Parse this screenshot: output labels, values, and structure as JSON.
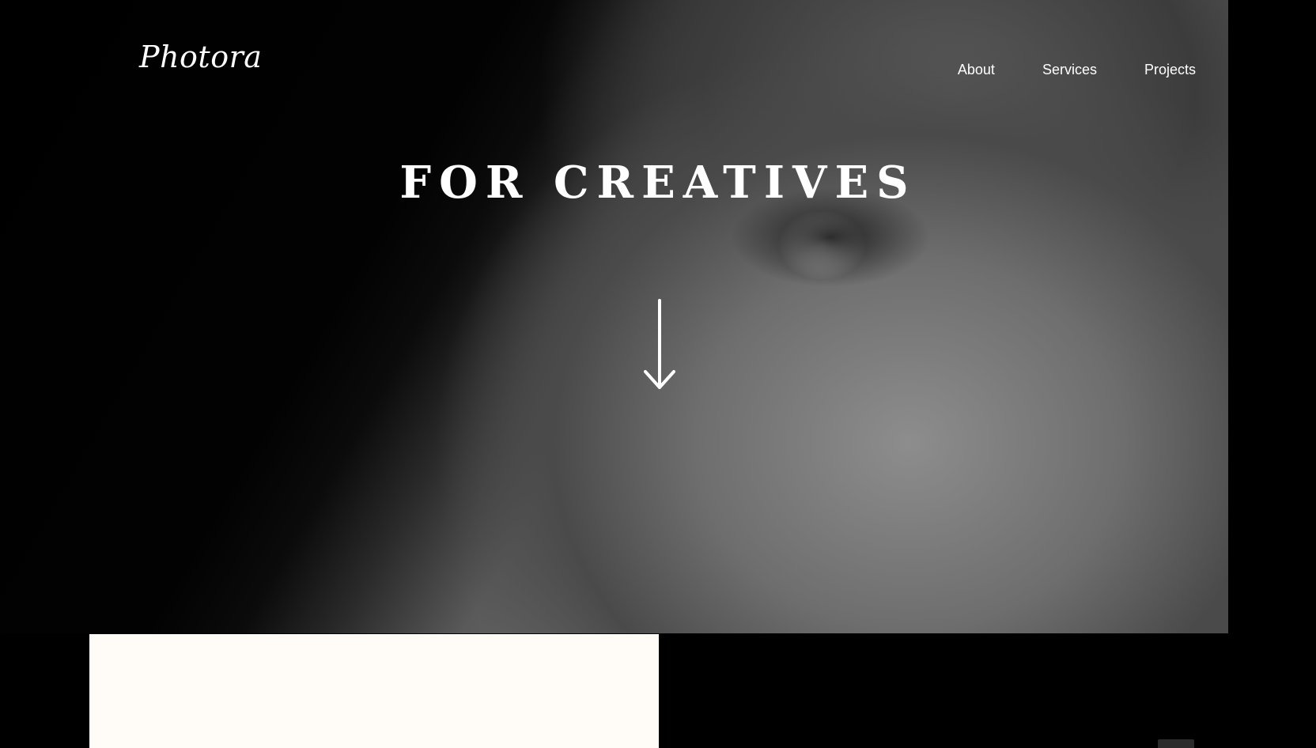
{
  "brand": {
    "logo_text": "Photora"
  },
  "nav": {
    "items": [
      {
        "label": "About"
      },
      {
        "label": "Services"
      },
      {
        "label": "Projects"
      }
    ]
  },
  "hero": {
    "title": "FOR CREATIVES",
    "photo": "grayscale close-up portrait showing an eye and freckled skin",
    "scroll_icon": "arrow-down-icon"
  },
  "colors": {
    "background": "#000000",
    "text": "#ffffff",
    "content_panel": "#fffcf7"
  }
}
